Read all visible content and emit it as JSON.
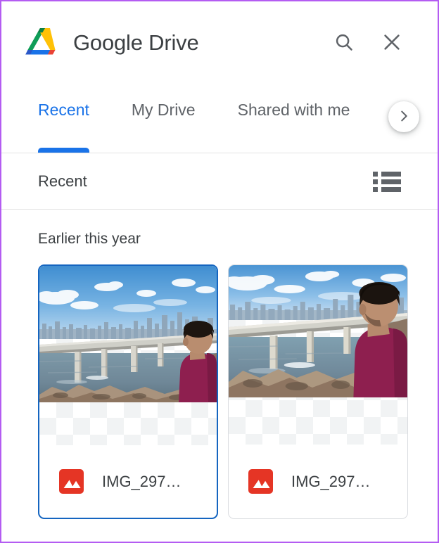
{
  "window": {
    "border_color": "#b45cf2"
  },
  "header": {
    "logo_icon": "google-drive-logo",
    "title": "Google Drive",
    "search_icon": "search-icon",
    "close_icon": "close-icon"
  },
  "tabs": {
    "items": [
      {
        "label": "Recent",
        "active": true
      },
      {
        "label": "My Drive",
        "active": false
      },
      {
        "label": "Shared with me",
        "active": false
      }
    ],
    "next_icon": "chevron-right-icon",
    "active_color": "#1a73e8"
  },
  "subheader": {
    "title": "Recent",
    "view_toggle_icon": "list-view-icon"
  },
  "content": {
    "section_title": "Earlier this year",
    "cards": [
      {
        "file_name": "IMG_297…",
        "file_type_icon": "image-file-icon",
        "file_type_color": "#e53525",
        "selected": true,
        "alt": "Man in maroon shirt sitting on rocks looking at a sea bridge with city skyline"
      },
      {
        "file_name": "IMG_297…",
        "file_type_icon": "image-file-icon",
        "file_type_color": "#e53525",
        "selected": false,
        "alt": "Man in maroon shirt sitting on rocks looking at a sea bridge with city skyline, closer crop"
      }
    ]
  }
}
